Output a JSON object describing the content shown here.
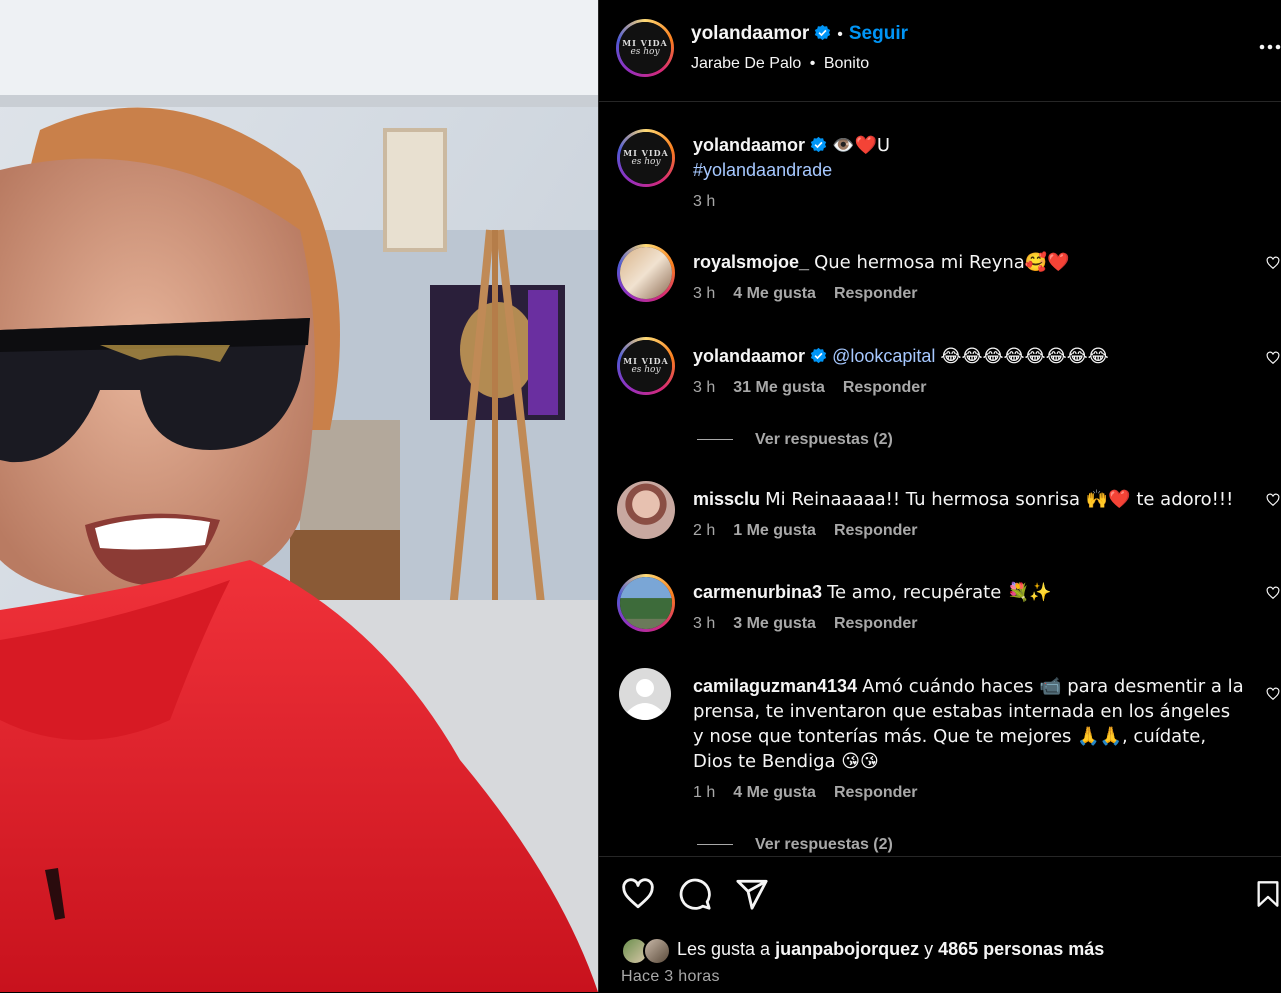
{
  "post": {
    "username": "yolandaamor",
    "follow_label": "Seguir",
    "separator": "•",
    "audio_artist": "Jarabe De Palo",
    "audio_sep": "•",
    "audio_track": "Bonito",
    "avatar_logo_top": "MI VIDA",
    "avatar_logo_bottom": "es hoy"
  },
  "caption": {
    "username": "yolandaamor",
    "text": "👁️❤️U",
    "hashtag": "#yolandaandrade",
    "time": "3 h"
  },
  "comments": [
    {
      "username": "royalsmojoe_",
      "text": "Que hermosa mi Reyna🥰❤️",
      "time": "3 h",
      "likes": "4 Me gusta",
      "reply": "Responder"
    },
    {
      "username": "yolandaamor",
      "mention": "@lookcapital",
      "text": "😂😂😂😂😂😂😂😂",
      "time": "3 h",
      "likes": "31 Me gusta",
      "reply": "Responder",
      "view_replies": "Ver respuestas (2)"
    },
    {
      "username": "missclu",
      "text": "Mi Reinaaaaa!! Tu hermosa sonrisa 🙌❤️ te adoro!!!",
      "time": "2 h",
      "likes": "1 Me gusta",
      "reply": "Responder"
    },
    {
      "username": "carmenurbina3",
      "text": "Te amo, recupérate 💐✨",
      "time": "3 h",
      "likes": "3 Me gusta",
      "reply": "Responder"
    },
    {
      "username": "camilaguzman4134",
      "text": "Amó cuándo haces 📹 para desmentir a la prensa, te inventaron que estabas internada en los ángeles y nose que tonterías más. Que te mejores 🙏🙏, cuídate, Dios te Bendiga 😘😘",
      "time": "1 h",
      "likes": "4 Me gusta",
      "reply": "Responder",
      "view_replies": "Ver respuestas (2)"
    }
  ],
  "footer": {
    "likes_prefix": "Les gusta a",
    "likes_user": "juanpabojorquez",
    "likes_and": "y",
    "likes_count": "4865 personas más",
    "posted": "Hace 3 horas"
  },
  "colors": {
    "background": "#000000",
    "link_blue": "#0095f6",
    "verified_blue": "#0095f6",
    "secondary_text": "#a8a8a8",
    "jacket_red": "#e3202b"
  },
  "icons": [
    "verified-icon",
    "more-options-icon",
    "like-icon",
    "comment-icon",
    "share-icon",
    "save-icon",
    "comment-like-icon"
  ]
}
